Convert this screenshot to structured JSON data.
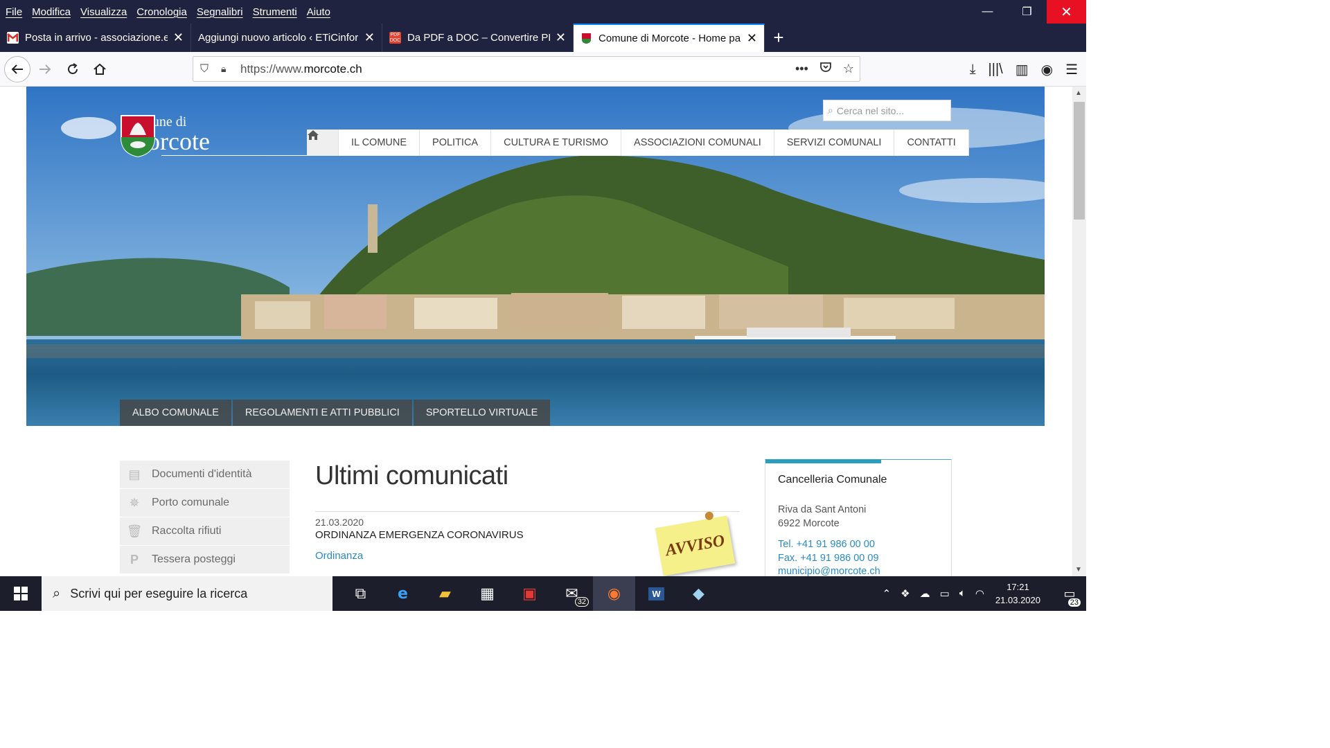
{
  "menubar": {
    "items": [
      "File",
      "Modifica",
      "Visualizza",
      "Cronologia",
      "Segnalibri",
      "Strumenti",
      "Aiuto"
    ]
  },
  "window_controls": {
    "minimize": "—",
    "restore": "❐",
    "close": "✕"
  },
  "tabs": [
    {
      "title": "Posta in arrivo - associazione.et",
      "icon": "gmail-icon",
      "color": "#d93025"
    },
    {
      "title": "Aggiungi nuovo articolo ‹ ETiCinfor",
      "icon": "wordpress-icon",
      "color": "#202340"
    },
    {
      "title": "Da PDF a DOC – Convertire PDF",
      "icon": "pdf-doc-icon",
      "color": "#e5412e"
    },
    {
      "title": "Comune di Morcote - Home pa",
      "icon": "morcote-crest-icon",
      "color": "#2e8b3a"
    }
  ],
  "url": {
    "prefix": "https://www.",
    "domain": "morcote.ch"
  },
  "site": {
    "logo_line1": "Comune di",
    "logo_line2": "Morcote",
    "search_placeholder": "Cerca nel sito...",
    "nav": [
      "IL COMUNE",
      "POLITICA",
      "CULTURA E TURISMO",
      "ASSOCIAZIONI COMUNALI",
      "SERVIZI COMUNALI",
      "CONTATTI"
    ],
    "subnav": [
      "ALBO COMUNALE",
      "REGOLAMENTI E ATTI PUBBLICI",
      "SPORTELLO VIRTUALE"
    ],
    "sidebar": [
      {
        "label": "Documenti d'identità",
        "icon": "id-card-icon"
      },
      {
        "label": "Porto comunale",
        "icon": "ship-wheel-icon"
      },
      {
        "label": "Raccolta rifiuti",
        "icon": "trash-icon"
      },
      {
        "label": "Tessera posteggi",
        "icon": "parking-icon"
      }
    ],
    "heading": "Ultimi comunicati",
    "news": {
      "date": "21.03.2020",
      "title": "ORDINANZA EMERGENZA CORONAVIRUS",
      "link": "Ordinanza"
    },
    "sticker": "AVVISO",
    "infobox": {
      "title": "Cancelleria Comunale",
      "address1": "Riva da Sant Antoni",
      "address2": "6922 Morcote",
      "tel": "Tel. +41 91 986 00 00",
      "fax": "Fax. +41 91 986 00 09",
      "email": "municipio@morcote.ch"
    }
  },
  "taskbar": {
    "search_placeholder": "Scrivi qui per eseguire la ricerca",
    "mail_badge": "32",
    "time": "17:21",
    "date": "21.03.2020",
    "notifications": "23"
  }
}
